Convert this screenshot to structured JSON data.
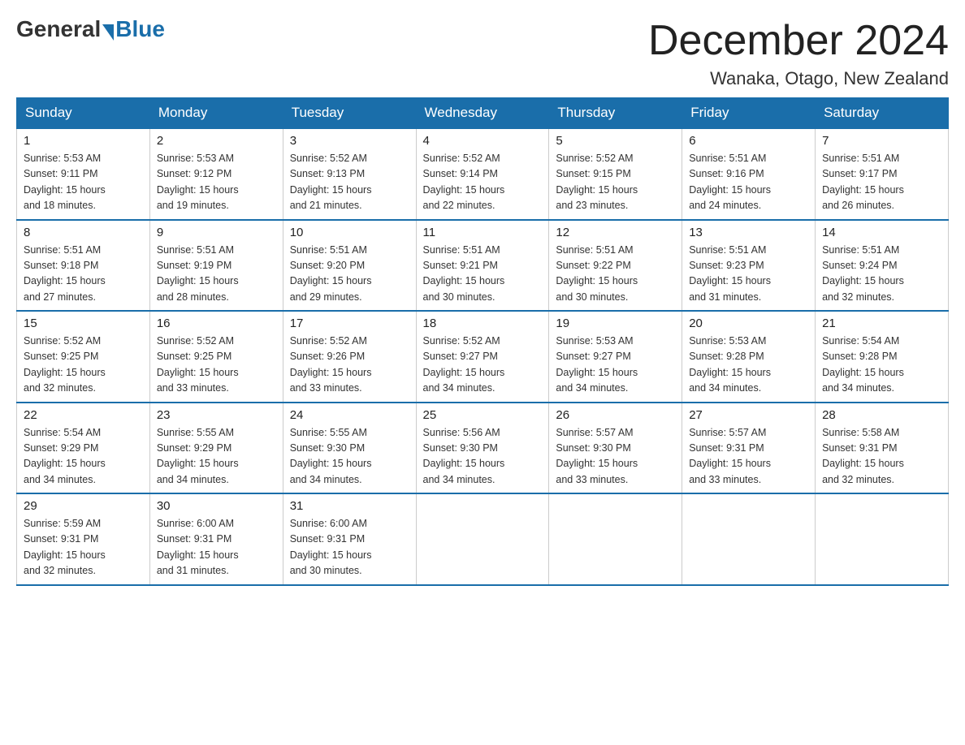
{
  "header": {
    "logo_general": "General",
    "logo_blue": "Blue",
    "month_title": "December 2024",
    "location": "Wanaka, Otago, New Zealand"
  },
  "days_of_week": [
    "Sunday",
    "Monday",
    "Tuesday",
    "Wednesday",
    "Thursday",
    "Friday",
    "Saturday"
  ],
  "weeks": [
    [
      {
        "day": "1",
        "info": "Sunrise: 5:53 AM\nSunset: 9:11 PM\nDaylight: 15 hours\nand 18 minutes."
      },
      {
        "day": "2",
        "info": "Sunrise: 5:53 AM\nSunset: 9:12 PM\nDaylight: 15 hours\nand 19 minutes."
      },
      {
        "day": "3",
        "info": "Sunrise: 5:52 AM\nSunset: 9:13 PM\nDaylight: 15 hours\nand 21 minutes."
      },
      {
        "day": "4",
        "info": "Sunrise: 5:52 AM\nSunset: 9:14 PM\nDaylight: 15 hours\nand 22 minutes."
      },
      {
        "day": "5",
        "info": "Sunrise: 5:52 AM\nSunset: 9:15 PM\nDaylight: 15 hours\nand 23 minutes."
      },
      {
        "day": "6",
        "info": "Sunrise: 5:51 AM\nSunset: 9:16 PM\nDaylight: 15 hours\nand 24 minutes."
      },
      {
        "day": "7",
        "info": "Sunrise: 5:51 AM\nSunset: 9:17 PM\nDaylight: 15 hours\nand 26 minutes."
      }
    ],
    [
      {
        "day": "8",
        "info": "Sunrise: 5:51 AM\nSunset: 9:18 PM\nDaylight: 15 hours\nand 27 minutes."
      },
      {
        "day": "9",
        "info": "Sunrise: 5:51 AM\nSunset: 9:19 PM\nDaylight: 15 hours\nand 28 minutes."
      },
      {
        "day": "10",
        "info": "Sunrise: 5:51 AM\nSunset: 9:20 PM\nDaylight: 15 hours\nand 29 minutes."
      },
      {
        "day": "11",
        "info": "Sunrise: 5:51 AM\nSunset: 9:21 PM\nDaylight: 15 hours\nand 30 minutes."
      },
      {
        "day": "12",
        "info": "Sunrise: 5:51 AM\nSunset: 9:22 PM\nDaylight: 15 hours\nand 30 minutes."
      },
      {
        "day": "13",
        "info": "Sunrise: 5:51 AM\nSunset: 9:23 PM\nDaylight: 15 hours\nand 31 minutes."
      },
      {
        "day": "14",
        "info": "Sunrise: 5:51 AM\nSunset: 9:24 PM\nDaylight: 15 hours\nand 32 minutes."
      }
    ],
    [
      {
        "day": "15",
        "info": "Sunrise: 5:52 AM\nSunset: 9:25 PM\nDaylight: 15 hours\nand 32 minutes."
      },
      {
        "day": "16",
        "info": "Sunrise: 5:52 AM\nSunset: 9:25 PM\nDaylight: 15 hours\nand 33 minutes."
      },
      {
        "day": "17",
        "info": "Sunrise: 5:52 AM\nSunset: 9:26 PM\nDaylight: 15 hours\nand 33 minutes."
      },
      {
        "day": "18",
        "info": "Sunrise: 5:52 AM\nSunset: 9:27 PM\nDaylight: 15 hours\nand 34 minutes."
      },
      {
        "day": "19",
        "info": "Sunrise: 5:53 AM\nSunset: 9:27 PM\nDaylight: 15 hours\nand 34 minutes."
      },
      {
        "day": "20",
        "info": "Sunrise: 5:53 AM\nSunset: 9:28 PM\nDaylight: 15 hours\nand 34 minutes."
      },
      {
        "day": "21",
        "info": "Sunrise: 5:54 AM\nSunset: 9:28 PM\nDaylight: 15 hours\nand 34 minutes."
      }
    ],
    [
      {
        "day": "22",
        "info": "Sunrise: 5:54 AM\nSunset: 9:29 PM\nDaylight: 15 hours\nand 34 minutes."
      },
      {
        "day": "23",
        "info": "Sunrise: 5:55 AM\nSunset: 9:29 PM\nDaylight: 15 hours\nand 34 minutes."
      },
      {
        "day": "24",
        "info": "Sunrise: 5:55 AM\nSunset: 9:30 PM\nDaylight: 15 hours\nand 34 minutes."
      },
      {
        "day": "25",
        "info": "Sunrise: 5:56 AM\nSunset: 9:30 PM\nDaylight: 15 hours\nand 34 minutes."
      },
      {
        "day": "26",
        "info": "Sunrise: 5:57 AM\nSunset: 9:30 PM\nDaylight: 15 hours\nand 33 minutes."
      },
      {
        "day": "27",
        "info": "Sunrise: 5:57 AM\nSunset: 9:31 PM\nDaylight: 15 hours\nand 33 minutes."
      },
      {
        "day": "28",
        "info": "Sunrise: 5:58 AM\nSunset: 9:31 PM\nDaylight: 15 hours\nand 32 minutes."
      }
    ],
    [
      {
        "day": "29",
        "info": "Sunrise: 5:59 AM\nSunset: 9:31 PM\nDaylight: 15 hours\nand 32 minutes."
      },
      {
        "day": "30",
        "info": "Sunrise: 6:00 AM\nSunset: 9:31 PM\nDaylight: 15 hours\nand 31 minutes."
      },
      {
        "day": "31",
        "info": "Sunrise: 6:00 AM\nSunset: 9:31 PM\nDaylight: 15 hours\nand 30 minutes."
      },
      null,
      null,
      null,
      null
    ]
  ]
}
